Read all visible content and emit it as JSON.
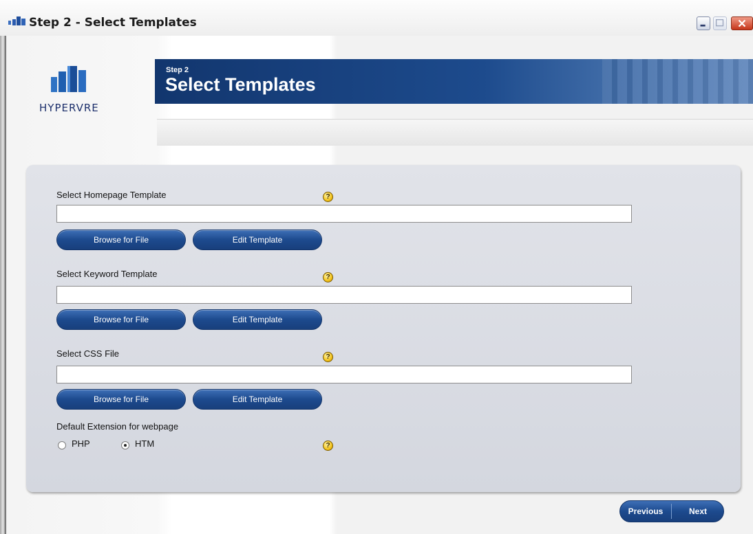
{
  "window": {
    "title": "Step 2 - Select Templates",
    "app_icon": "hypervre-app-icon",
    "controls": [
      "minimize",
      "maximize",
      "close"
    ]
  },
  "header": {
    "logo_text": "HYPERVRE",
    "step": "Step 2",
    "title": "Select Templates"
  },
  "form": {
    "homepage": {
      "label": "Select Homepage Template",
      "value": "",
      "browse_label": "Browse for File",
      "edit_label": "Edit Template",
      "help_icon": "help-icon"
    },
    "keyword": {
      "label": "Select Keyword Template",
      "value": "",
      "browse_label": "Browse for File",
      "edit_label": "Edit Template",
      "help_icon": "help-icon"
    },
    "css": {
      "label": "Select CSS File",
      "value": "",
      "browse_label": "Browse for File",
      "edit_label": "Edit Template",
      "help_icon": "help-icon"
    },
    "extension": {
      "label": "Default Extension for webpage",
      "options": [
        {
          "label": "PHP",
          "selected": false
        },
        {
          "label": "HTM",
          "selected": true
        }
      ],
      "help_icon": "help-icon"
    }
  },
  "nav": {
    "previous_label": "Previous",
    "next_label": "Next"
  },
  "colors": {
    "banner_blue": "#1d4b8d",
    "button_blue": "#1d4a8e",
    "panel_gray": "#d8dbe2",
    "help_yellow": "#f2c21a"
  }
}
